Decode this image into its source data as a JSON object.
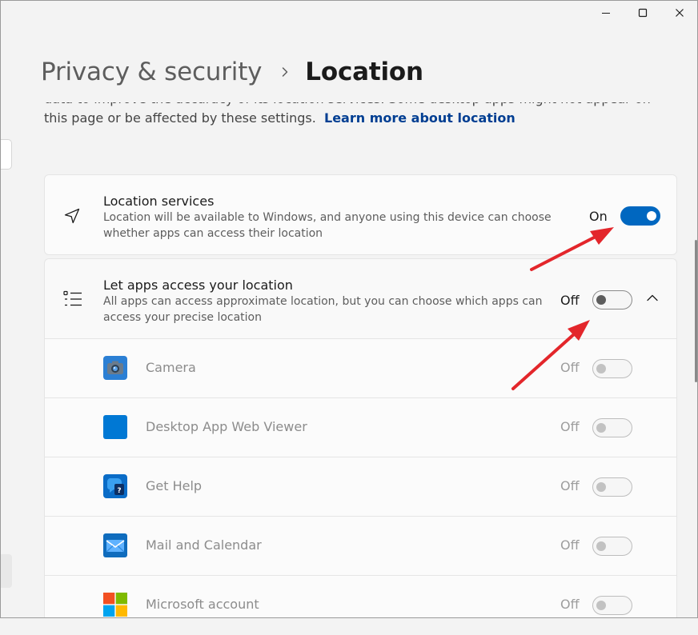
{
  "breadcrumb": {
    "parent": "Privacy & security",
    "current": "Location"
  },
  "description": {
    "text": "data to improve the accuracy of its location services. Some desktop apps might not appear on this page or be affected by these settings.",
    "link": "Learn more about location"
  },
  "location_services": {
    "icon": "navigation-arrow-icon",
    "title": "Location services",
    "subtitle": "Location will be available to Windows, and anyone using this device can choose whether apps can access their location",
    "state": "On"
  },
  "apps_access": {
    "icon": "bulleted-list-icon",
    "title": "Let apps access your location",
    "subtitle": "All apps can access approximate location, but you can choose which apps can access your precise location",
    "state": "Off",
    "apps": [
      {
        "name": "Camera",
        "state": "Off",
        "icon": "camera-app-icon"
      },
      {
        "name": "Desktop App Web Viewer",
        "state": "Off",
        "icon": "web-viewer-app-icon"
      },
      {
        "name": "Get Help",
        "state": "Off",
        "icon": "get-help-app-icon"
      },
      {
        "name": "Mail and Calendar",
        "state": "Off",
        "icon": "mail-app-icon"
      },
      {
        "name": "Microsoft account",
        "state": "Off",
        "icon": "microsoft-logo-icon"
      }
    ]
  },
  "colors": {
    "accent": "#0067c0",
    "link": "#003e92",
    "annotation_arrow": "#e3262b"
  }
}
